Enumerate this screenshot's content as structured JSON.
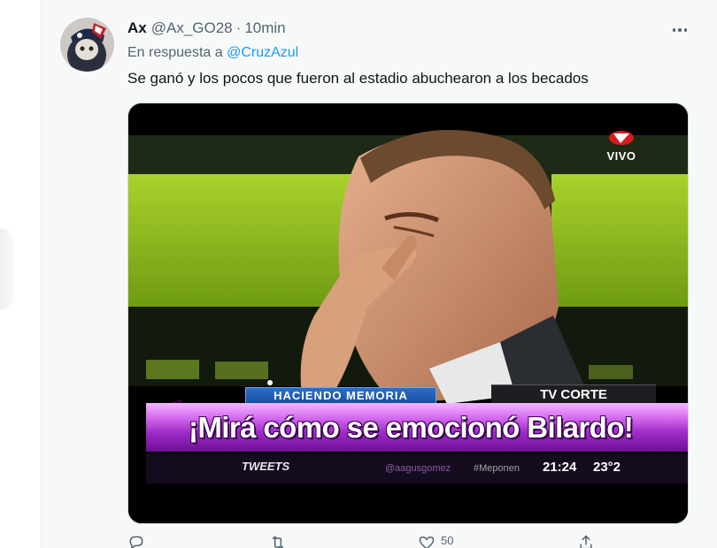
{
  "tweet": {
    "display_name": "Ax",
    "handle": "@Ax_GO28",
    "separator": "·",
    "time": "10min",
    "reply_prefix": "En respuesta a",
    "reply_to": "@CruzAzul",
    "text": "Se ganó y los pocos que fueron al estadio abuchearon a los becados"
  },
  "media": {
    "live_badge": "VIVO",
    "segment_label": "HACIENDO MEMORIA",
    "channel_label": "TV CORTE",
    "headline": "¡Mirá cómo se emocionó Bilardo!",
    "ticker_label": "TWEETS",
    "ticker_handle": "@aagusgomez",
    "ticker_hashtag": "#Meponen",
    "ticker_clock": "21:24",
    "ticker_temp": "23°2"
  },
  "actions": {
    "like_count": "50"
  },
  "icons": {
    "more": "more-icon",
    "reply": "reply-icon",
    "retweet": "retweet-icon",
    "like": "heart-icon",
    "share": "share-icon"
  },
  "colors": {
    "accent": "#1d9bf0",
    "secondary_text": "#536471",
    "primary_text": "#0f1419",
    "background": "#f7f9f9"
  }
}
